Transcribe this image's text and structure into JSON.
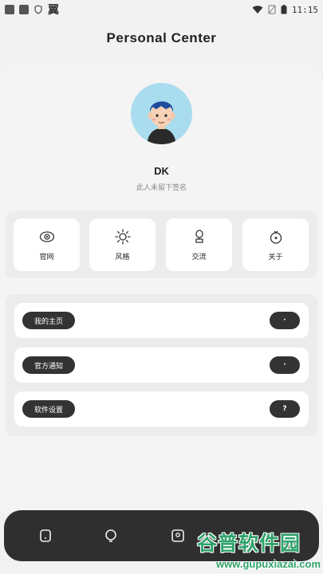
{
  "status_bar": {
    "left_text": "翼",
    "time": "11:15"
  },
  "header": {
    "title": "Personal Center"
  },
  "profile": {
    "name": "DK",
    "signature": "此人未留下签名"
  },
  "quick_actions": [
    {
      "label": "官网",
      "icon": "eye-icon"
    },
    {
      "label": "风格",
      "icon": "sun-icon"
    },
    {
      "label": "交流",
      "icon": "chat-icon"
    },
    {
      "label": "关于",
      "icon": "info-icon"
    }
  ],
  "menu": [
    {
      "label": "我的主页",
      "badge": "·"
    },
    {
      "label": "官方通知",
      "badge": "·"
    },
    {
      "label": "软件设置",
      "badge": "?"
    }
  ],
  "bottom_nav": [
    {
      "icon": "home-icon"
    },
    {
      "icon": "discover-icon"
    },
    {
      "icon": "profile-icon"
    }
  ],
  "watermark": {
    "main": "谷普软件园",
    "url": "www.gupuxiazai.com"
  },
  "colors": {
    "accent_dark": "#333333",
    "avatar_bg": "#a9dcef",
    "watermark_green": "#2ea36a"
  }
}
